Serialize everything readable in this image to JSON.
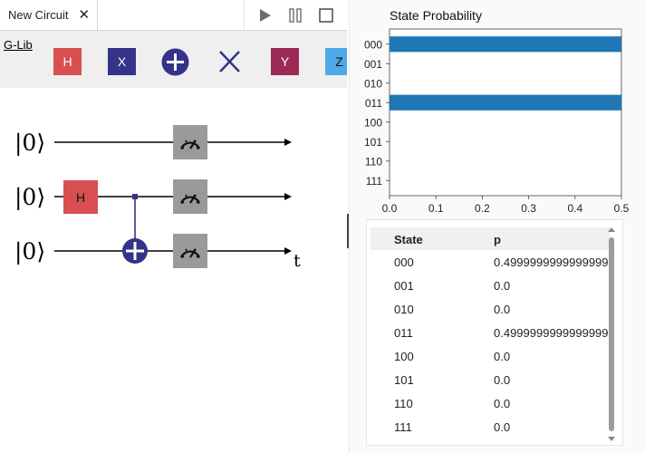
{
  "tab": {
    "title": "New Circuit",
    "close_glyph": "✕"
  },
  "toolbar": {
    "run_icon": "play-icon",
    "pause_icon": "pause-icon",
    "stop_icon": "stop-icon"
  },
  "palette": {
    "library_link": "G-Lib",
    "gates": [
      {
        "label": "H",
        "color": "#d94f4f",
        "kind": "text"
      },
      {
        "label": "X",
        "color": "#33338a",
        "kind": "text"
      },
      {
        "label": "",
        "color": "#33338a",
        "kind": "cnot-icon"
      },
      {
        "label": "",
        "color": "#33338a",
        "kind": "swap-icon"
      },
      {
        "label": "Y",
        "color": "#9b2a55",
        "kind": "text"
      },
      {
        "label": "Z",
        "color": "#4fa8e8",
        "kind": "text"
      }
    ]
  },
  "circuit": {
    "qubits": [
      {
        "ket": "|0⟩"
      },
      {
        "ket": "|0⟩"
      },
      {
        "ket": "|0⟩"
      }
    ],
    "gates": {
      "h_label": "H"
    },
    "time_label": "t",
    "colors": {
      "h_gate": "#d94f4f",
      "control": "#33338a",
      "measure": "#9a9a9a"
    }
  },
  "chart_data": {
    "type": "bar",
    "orientation": "horizontal",
    "title": "State Probability",
    "categories": [
      "000",
      "001",
      "010",
      "011",
      "100",
      "101",
      "110",
      "111"
    ],
    "values": [
      0.5,
      0,
      0,
      0.5,
      0,
      0,
      0,
      0
    ],
    "xlim": [
      0,
      0.5
    ],
    "xticks": [
      "0.0",
      "0.1",
      "0.2",
      "0.3",
      "0.4",
      "0.5"
    ],
    "bar_color": "#1f77b4",
    "grid": false
  },
  "table": {
    "headers": {
      "state": "State",
      "p": "p"
    },
    "rows": [
      {
        "state": "000",
        "p": "0.4999999999999999"
      },
      {
        "state": "001",
        "p": "0.0"
      },
      {
        "state": "010",
        "p": "0.0"
      },
      {
        "state": "011",
        "p": "0.4999999999999999"
      },
      {
        "state": "100",
        "p": "0.0"
      },
      {
        "state": "101",
        "p": "0.0"
      },
      {
        "state": "110",
        "p": "0.0"
      },
      {
        "state": "111",
        "p": "0.0"
      }
    ]
  }
}
